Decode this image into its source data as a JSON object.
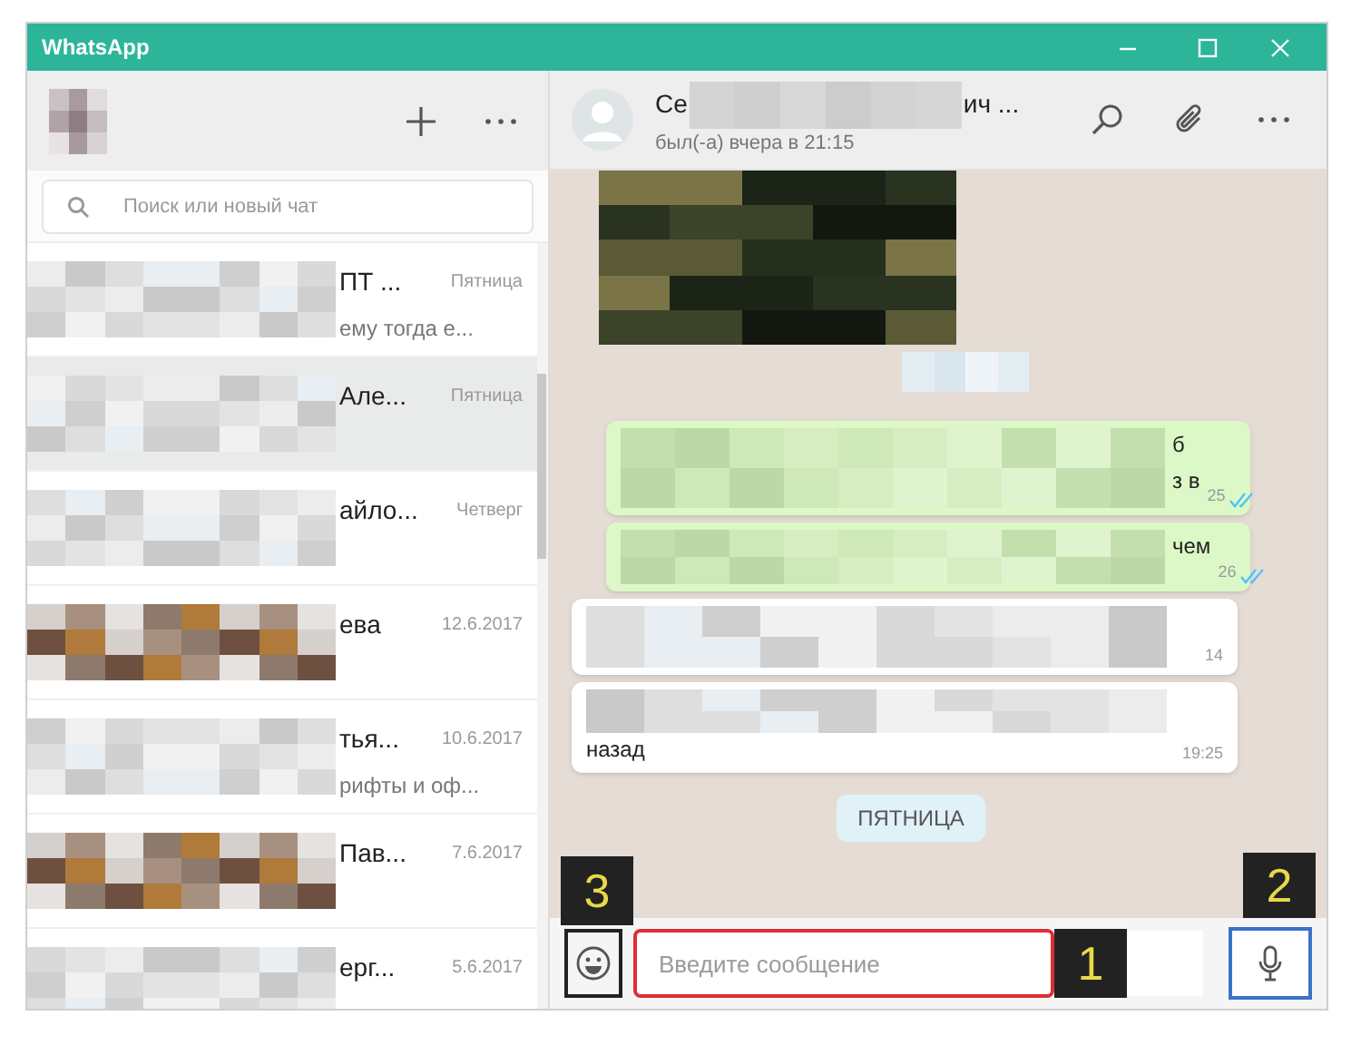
{
  "window": {
    "title": "WhatsApp"
  },
  "sidebar": {
    "search": {
      "placeholder": "Поиск или новый чат"
    },
    "chats": [
      {
        "kind": "blurred",
        "name": "ПТ ...",
        "time": "Пятница",
        "preview": "ему тогда е...",
        "selected": false
      },
      {
        "kind": "blurred",
        "name": "Але...",
        "time": "Пятница",
        "selected": true
      },
      {
        "kind": "blurred",
        "name": "айло...",
        "time": "Четверг",
        "selected": false
      },
      {
        "kind": "photo",
        "name": "ева",
        "time": "12.6.2017",
        "selected": false
      },
      {
        "kind": "blurred",
        "name": "тья...",
        "time": "10.6.2017",
        "preview": "рифты и оф...",
        "selected": false
      },
      {
        "kind": "photo",
        "name": "Пав...",
        "time": "7.6.2017",
        "selected": false
      },
      {
        "kind": "blurred",
        "name": "ерг...",
        "time": "5.6.2017",
        "selected": false
      }
    ]
  },
  "chat": {
    "contact_start": "Се",
    "contact_end": "ич ...",
    "status": "был(-а) вчера в 21:15",
    "messages": [
      {
        "kind": "photo"
      },
      {
        "kind": "date_blurred"
      },
      {
        "kind": "outgoing",
        "lines": [
          "б",
          "з в"
        ],
        "time": "25",
        "read": true
      },
      {
        "kind": "outgoing",
        "lines": [
          "чем"
        ],
        "time": "26",
        "read": true
      },
      {
        "kind": "incoming",
        "time": "14"
      },
      {
        "kind": "incoming",
        "lines": [
          "назад"
        ],
        "time": "19:25"
      },
      {
        "kind": "date",
        "text": "ПЯТНИЦА"
      }
    ],
    "composer": {
      "placeholder": "Введите сообщение"
    }
  },
  "annotations": {
    "input": "1",
    "mic": "2",
    "emoji": "3"
  }
}
